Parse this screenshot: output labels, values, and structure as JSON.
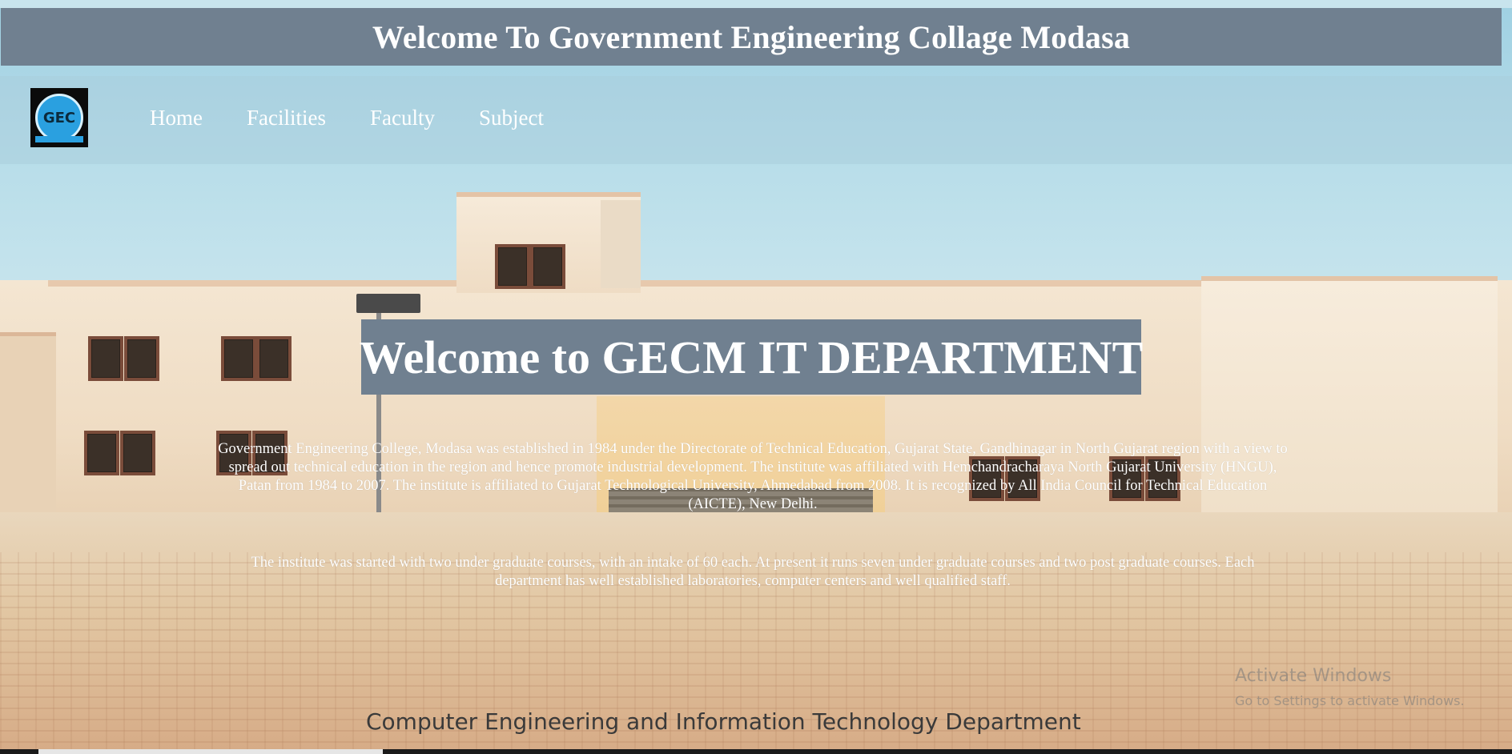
{
  "header": {
    "title": "Welcome To Government Engineering Collage Modasa"
  },
  "logo": {
    "alt": "college-logo"
  },
  "nav": {
    "items": [
      {
        "label": "Home"
      },
      {
        "label": "Facilities"
      },
      {
        "label": "Faculty"
      },
      {
        "label": "Subject"
      }
    ]
  },
  "hero": {
    "title": "Welcome to GECM IT DEPARTMENT",
    "paragraph1": "Government Engineering College, Modasa was established in 1984 under the Directorate of Technical Education, Gujarat State, Gandhinagar in North Gujarat region with a view to spread out technical education in the region and hence promote industrial development. The institute was affiliated with Hemchandracharaya North Gujarat University (HNGU), Patan from 1984 to 2007. The institute is affiliated to Gujarat Technological University, Ahmedabad from 2008. It is recognized by All India Council for Technical Education (AICTE), New Delhi.",
    "paragraph2": "The institute was started with two under graduate courses, with an intake of 60 each. At present it runs seven under graduate courses and two post graduate courses. Each department has well established laboratories, computer centers and well qualified staff."
  },
  "background": {
    "caption": "Computer Engineering and Information Technology Department"
  },
  "os_watermark": {
    "title": "Activate Windows",
    "subtitle": "Go to Settings to activate Windows."
  },
  "colors": {
    "banner": "#708090",
    "nav_text": "#ffffff"
  }
}
